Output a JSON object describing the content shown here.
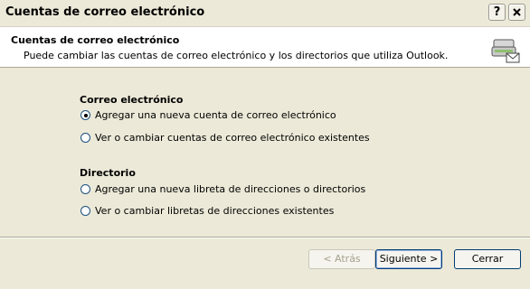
{
  "window": {
    "title": "Cuentas de correo electrónico",
    "help_label": "?",
    "close_label": "X"
  },
  "header": {
    "title": "Cuentas de correo electrónico",
    "subtitle": "Puede cambiar las cuentas de correo electrónico y los directorios que utiliza Outlook.",
    "icon": "mail-accounts-icon"
  },
  "email_section": {
    "title": "Correo electrónico",
    "options": [
      {
        "label": "Agregar una nueva cuenta de correo electrónico",
        "checked": true
      },
      {
        "label": "Ver o cambiar cuentas de correo electrónico existentes",
        "checked": false
      }
    ]
  },
  "directory_section": {
    "title": "Directorio",
    "options": [
      {
        "label": "Agregar una nueva libreta de direcciones o directorios",
        "checked": false
      },
      {
        "label": "Ver o cambiar libretas de direcciones existentes",
        "checked": false
      }
    ]
  },
  "buttons": {
    "back": "< Atrás",
    "next": "Siguiente >",
    "close": "Cerrar"
  }
}
